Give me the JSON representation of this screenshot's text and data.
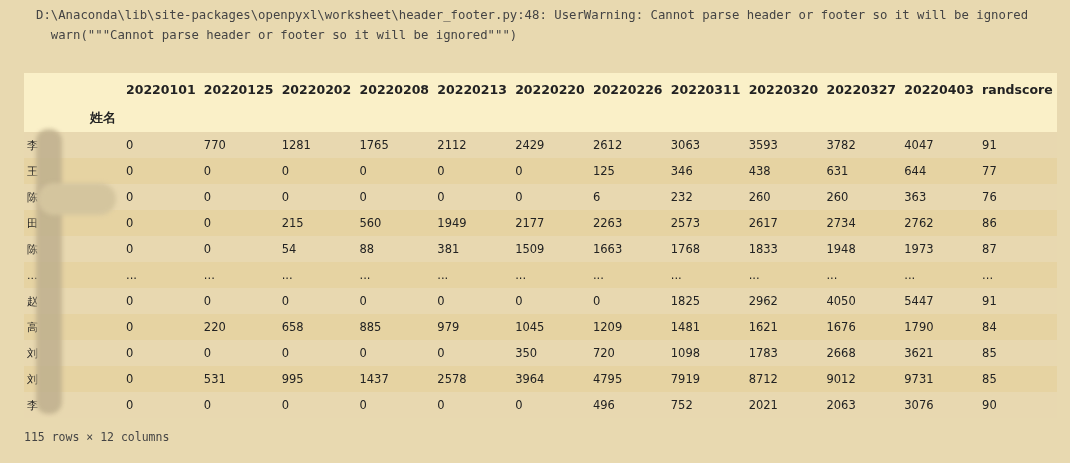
{
  "warning": {
    "lines": [
      "D:\\Anaconda\\lib\\site-packages\\openpyxl\\worksheet\\header_footer.py:48: UserWarning: Cannot parse header or footer so it will be ignored",
      "  warn(\"\"\"Cannot parse header or footer so it will be ignored\"\"\")"
    ]
  },
  "table": {
    "columns": [
      "20220101",
      "20220125",
      "20220202",
      "20220208",
      "20220213",
      "20220220",
      "20220226",
      "20220311",
      "20220320",
      "20220327",
      "20220403",
      "randscore"
    ],
    "index_name": "姓名",
    "rows": [
      {
        "index": "李",
        "cells": [
          "0",
          "770",
          "1281",
          "1765",
          "2112",
          "2429",
          "2612",
          "3063",
          "3593",
          "3782",
          "4047",
          "91"
        ]
      },
      {
        "index": "王",
        "cells": [
          "0",
          "0",
          "0",
          "0",
          "0",
          "0",
          "125",
          "346",
          "438",
          "631",
          "644",
          "77"
        ]
      },
      {
        "index": "陈",
        "cells": [
          "0",
          "0",
          "0",
          "0",
          "0",
          "0",
          "6",
          "232",
          "260",
          "260",
          "363",
          "76"
        ]
      },
      {
        "index": "田",
        "cells": [
          "0",
          "0",
          "215",
          "560",
          "1949",
          "2177",
          "2263",
          "2573",
          "2617",
          "2734",
          "2762",
          "86"
        ]
      },
      {
        "index": "陈",
        "cells": [
          "0",
          "0",
          "54",
          "88",
          "381",
          "1509",
          "1663",
          "1768",
          "1833",
          "1948",
          "1973",
          "87"
        ]
      },
      {
        "index": "...",
        "cells": [
          "...",
          "...",
          "...",
          "...",
          "...",
          "...",
          "...",
          "...",
          "...",
          "...",
          "...",
          "..."
        ]
      },
      {
        "index": "赵",
        "cells": [
          "0",
          "0",
          "0",
          "0",
          "0",
          "0",
          "0",
          "1825",
          "2962",
          "4050",
          "5447",
          "91"
        ]
      },
      {
        "index": "高",
        "cells": [
          "0",
          "220",
          "658",
          "885",
          "979",
          "1045",
          "1209",
          "1481",
          "1621",
          "1676",
          "1790",
          "84"
        ]
      },
      {
        "index": "刘",
        "cells": [
          "0",
          "0",
          "0",
          "0",
          "0",
          "350",
          "720",
          "1098",
          "1783",
          "2668",
          "3621",
          "85"
        ]
      },
      {
        "index": "刘",
        "cells": [
          "0",
          "531",
          "995",
          "1437",
          "2578",
          "3964",
          "4795",
          "7919",
          "8712",
          "9012",
          "9731",
          "85"
        ]
      },
      {
        "index": "李",
        "cells": [
          "0",
          "0",
          "0",
          "0",
          "0",
          "0",
          "496",
          "752",
          "2021",
          "2063",
          "3076",
          "90"
        ]
      }
    ]
  },
  "footer": "115 rows × 12 columns"
}
